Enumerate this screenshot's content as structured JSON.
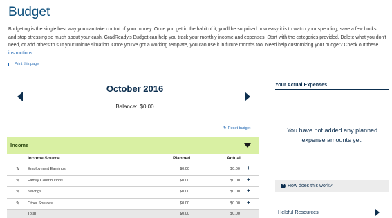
{
  "page": {
    "title": "Budget",
    "intro_text": "Budgeting is the single best way you can take control of your money. Once you get in the habit of it, you'll be surprised how easy it is to watch your spending, save a few bucks, and stop stressing so much about your cash. GradReady's Budget can help you track your monthly income and expenses. Start with the categories provided. Delete what you don't need, or add others to suit your unique situation. Once you've got a working template, you can use it in future months too. Need help customizing your budget? Check out these ",
    "intro_link": "instructions",
    "print_label": "Print this page"
  },
  "budget": {
    "month": "October 2016",
    "balance_label": "Balance:",
    "balance_value": "$0.00",
    "reset_label": "Reset budget"
  },
  "income": {
    "section_label": "Income",
    "columns": {
      "source": "Income Source",
      "planned": "Planned",
      "actual": "Actual"
    },
    "rows": [
      {
        "source": "Employment Earnings",
        "planned": "$0.00",
        "actual": "$0.00"
      },
      {
        "source": "Family Contributions",
        "planned": "$0.00",
        "actual": "$0.00"
      },
      {
        "source": "Savings",
        "planned": "$0.00",
        "actual": "$0.00"
      },
      {
        "source": "Other Sources",
        "planned": "$0.00",
        "actual": "$0.00"
      }
    ],
    "total": {
      "source": "Total",
      "planned": "$0.00",
      "actual": "$0.00"
    }
  },
  "sidebar": {
    "expenses_title": "Your Actual Expenses",
    "empty_message": "You have not added any planned expense amounts yet.",
    "how_label": "How does this work?",
    "helpful_label": "Helpful Resources"
  },
  "colors": {
    "title": "#0d4f7c",
    "link": "#1f66b2",
    "income_bar": "#d9f0a3",
    "navy": "#0d2f4f"
  }
}
